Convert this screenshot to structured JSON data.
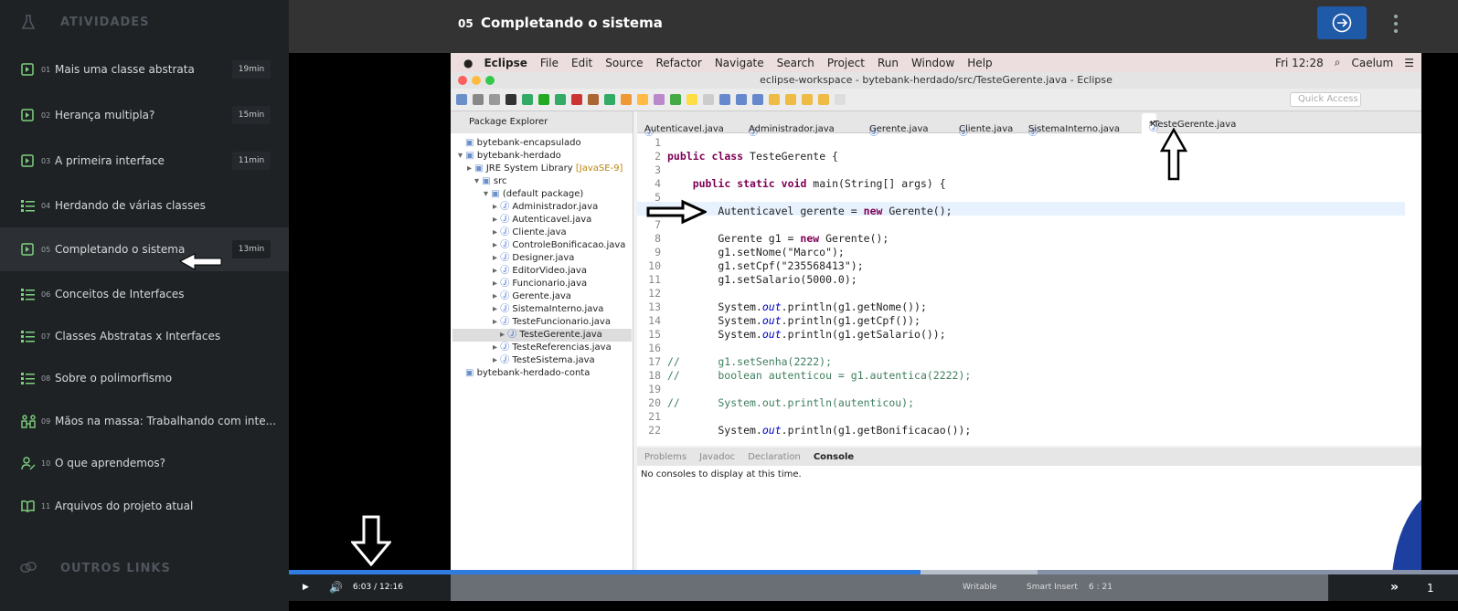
{
  "sidebar": {
    "section_title": "ATIVIDADES",
    "other_title": "OUTROS LINKS",
    "items": [
      {
        "num": "01",
        "label": "Mais uma classe abstrata",
        "duration": "19min",
        "icon": "video-icon"
      },
      {
        "num": "02",
        "label": "Herança multipla?",
        "duration": "15min",
        "icon": "video-icon"
      },
      {
        "num": "03",
        "label": "A primeira interface",
        "duration": "11min",
        "icon": "video-icon"
      },
      {
        "num": "04",
        "label": "Herdando de várias classes",
        "icon": "list-icon"
      },
      {
        "num": "05",
        "label": "Completando o sistema",
        "duration": "13min",
        "icon": "video-icon",
        "active": true
      },
      {
        "num": "06",
        "label": "Conceitos de Interfaces",
        "icon": "list-icon"
      },
      {
        "num": "07",
        "label": "Classes Abstratas x Interfaces",
        "icon": "list-icon"
      },
      {
        "num": "08",
        "label": "Sobre o polimorfismo",
        "icon": "list-icon"
      },
      {
        "num": "09",
        "label": "Mãos na massa: Trabalhando com inte...",
        "icon": "hands-on-icon"
      },
      {
        "num": "10",
        "label": "O que aprendemos?",
        "icon": "learned-icon"
      },
      {
        "num": "11",
        "label": "Arquivos do projeto atual",
        "icon": "book-icon"
      }
    ]
  },
  "header": {
    "num": "05",
    "title": "Completando o sistema"
  },
  "eclipse": {
    "menu": [
      "Eclipse",
      "File",
      "Edit",
      "Source",
      "Refactor",
      "Navigate",
      "Search",
      "Project",
      "Run",
      "Window",
      "Help"
    ],
    "clock": "Fri 12:28",
    "user": "Caelum",
    "window_title": "eclipse-workspace - bytebank-herdado/src/TesteGerente.java - Eclipse",
    "quick_access": "Quick Access",
    "package_explorer": "Package Explorer",
    "tree": [
      "bytebank-encapsulado",
      "bytebank-herdado",
      "JRE System Library",
      "[JavaSE-9]",
      "src",
      "(default package)",
      "Administrador.java",
      "Autenticavel.java",
      "Cliente.java",
      "ControleBonificacao.java",
      "Designer.java",
      "EditorVideo.java",
      "Funcionario.java",
      "Gerente.java",
      "SistemaInterno.java",
      "TesteFuncionario.java",
      "TesteGerente.java",
      "TesteReferencias.java",
      "TesteSistema.java",
      "bytebank-herdado-conta"
    ],
    "tabs": [
      "Autenticavel.java",
      "Administrador.java",
      "Gerente.java",
      "Cliente.java",
      "SistemaInterno.java",
      "*TesteGerente.java"
    ],
    "code": [
      "",
      "public class TesteGerente {",
      "",
      "    public static void main(String[] args) {",
      "",
      "        Autenticavel gerente = new Gerente();",
      "",
      "        Gerente g1 = new Gerente();",
      "        g1.setNome(\"Marco\");",
      "        g1.setCpf(\"235568413\");",
      "        g1.setSalario(5000.0);",
      "",
      "        System.out.println(g1.getNome());",
      "        System.out.println(g1.getCpf());",
      "        System.out.println(g1.getSalario());",
      "",
      "//      g1.setSenha(2222);",
      "//      boolean autenticou = g1.autentica(2222);",
      "",
      "//      System.out.println(autenticou);",
      "",
      "        System.out.println(g1.getBonificacao());"
    ],
    "console_tabs": [
      "Problems",
      "Javadoc",
      "Declaration",
      "Console"
    ],
    "console_msg": "No consoles to display at this time.",
    "status": [
      "Writable",
      "Smart Insert",
      "6 : 21"
    ]
  },
  "player": {
    "current": "6:03",
    "sep": "/",
    "total": "12:16",
    "progress_pct": 54,
    "buffered_pct": 64,
    "speed_partial": "1"
  },
  "colors": {
    "accent": "#1e5aa8",
    "icon_green": "#7ed07e",
    "progress": "#2f7be0"
  }
}
